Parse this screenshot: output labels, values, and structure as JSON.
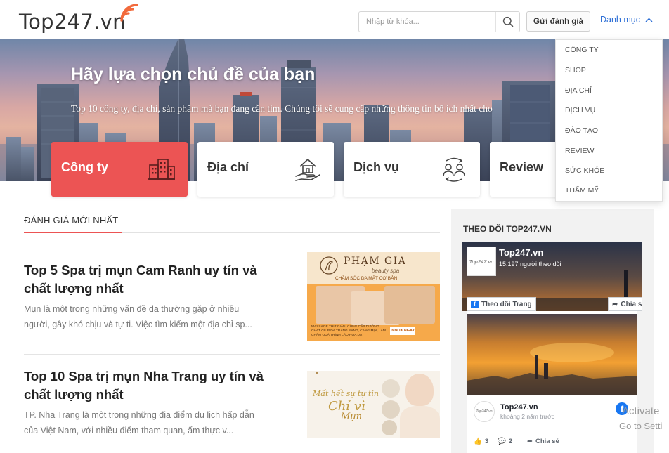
{
  "header": {
    "logo_text": "Top247.vn",
    "search_placeholder": "Nhập từ khóa...",
    "review_button": "Gửi đánh giá",
    "menu_label": "Danh mục"
  },
  "hero": {
    "title": "Hãy lựa chọn chủ đề của bạn",
    "subtitle": "Top 10 công ty, địa chỉ, sản phẩm mà bạn đang cần tìm. Chúng tôi sẽ cung cấp những thông tin bổ ích nhất cho"
  },
  "categories": [
    {
      "label": "Công ty",
      "icon": "buildings-icon",
      "active": true
    },
    {
      "label": "Địa chỉ",
      "icon": "house-hand-icon",
      "active": false
    },
    {
      "label": "Dịch vụ",
      "icon": "people-exchange-icon",
      "active": false
    },
    {
      "label": "Review",
      "icon": "review-icon",
      "active": false
    }
  ],
  "dropdown": {
    "items": [
      "CÔNG TY",
      "SHOP",
      "ĐỊA CHỈ",
      "DỊCH VỤ",
      "ĐÀO TẠO",
      "REVIEW",
      "SỨC KHỎE",
      "THẨM MỸ"
    ]
  },
  "reviews": {
    "section_title": "ĐÁNH GIÁ MỚI NHẤT",
    "articles": [
      {
        "title": "Top 5 Spa trị mụn Cam Ranh uy tín và chất lượng nhất",
        "excerpt": "Mụn là một trong những vấn đề da thường gặp ở nhiều người, gây khó chịu và tự ti. Việc tìm kiếm một địa chỉ sp...",
        "thumb": {
          "brand": "PHẠM GIA",
          "brand_sub": "beauty spa",
          "banner": "CHĂM SÓC DA MẶT CƠ BẢN",
          "promo": "MASSAGE THƯ GIÃN, CUNG CẤP DƯỠNG CHẤT GIÚP DA TRẮNG SÁNG, CĂNG MỊN, LÀM CHẬM QUÁ TRÌNH LÃO HÓA DA",
          "cta": "INBOX NGAY"
        }
      },
      {
        "title": "Top 10 Spa trị mụn Nha Trang uy tín và chất lượng nhất",
        "excerpt": "TP. Nha Trang là một trong những địa điểm du lịch hấp dẫn của Việt Nam, với nhiều điểm tham quan, ẩm thực v...",
        "thumb": {
          "line1": "Mất hết sự tự tin",
          "line2": "Chỉ vì",
          "line3": "Mụn"
        }
      }
    ]
  },
  "sidebar": {
    "title": "THEO DÕI TOP247.VN",
    "page_name": "Top247.vn",
    "followers": "15.197 người theo dõi",
    "follow_button": "Theo dõi Trang",
    "share_button": "Chia sẻ",
    "post_author": "Top247.vn",
    "post_time": "khoảng 2 năm trước",
    "likes": "3",
    "comments": "2",
    "share_label": "Chia sẻ",
    "logo_mini": "Top247.vn"
  },
  "overlay": {
    "line1": "Activate",
    "line2": "Go to Setti"
  },
  "colors": {
    "accent_red": "#ec5454",
    "link_blue": "#2d6fd6",
    "facebook_blue": "#1877f2"
  }
}
